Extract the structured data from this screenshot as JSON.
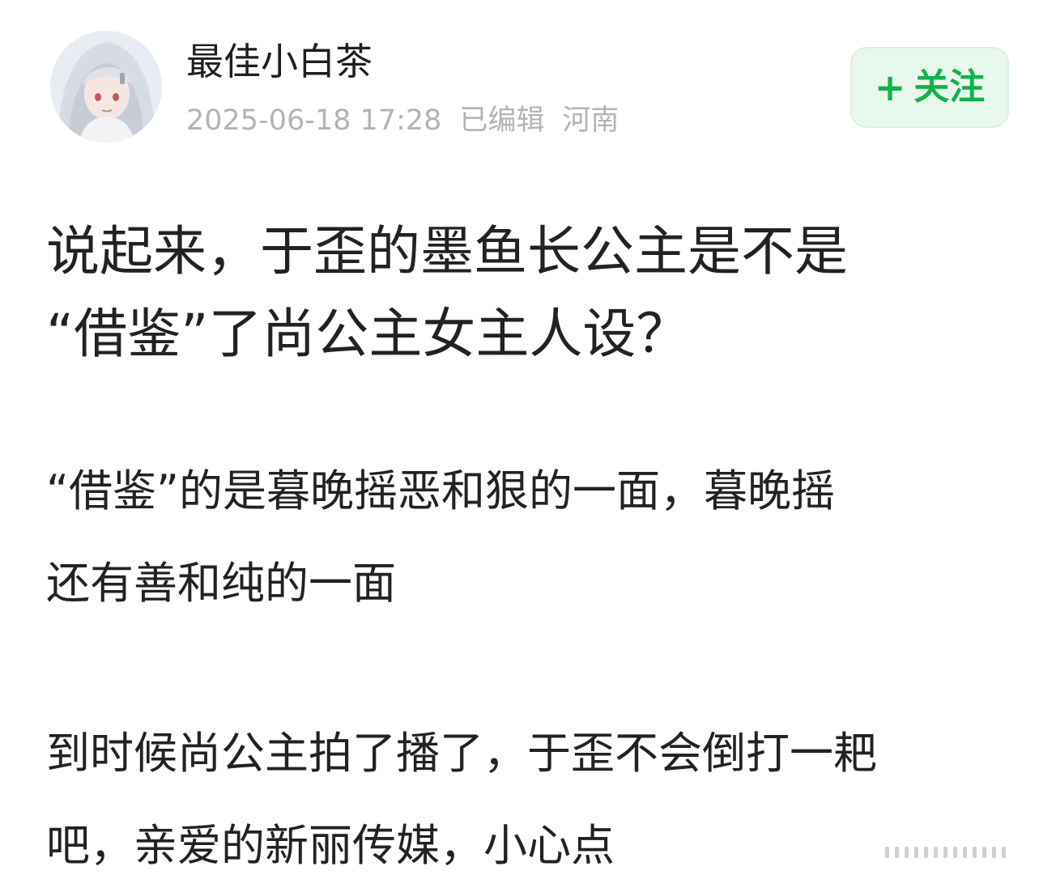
{
  "author": {
    "name": "最佳小白茶",
    "avatar_icon": "anime-girl-avatar"
  },
  "meta": {
    "timestamp": "2025-06-18 17:28",
    "edited": "已编辑",
    "location": "河南"
  },
  "follow": {
    "plus": "+",
    "label": "关注",
    "color": "#12b24b",
    "background": "#e9f8ec"
  },
  "post": {
    "title_line1": "说起来，于歪的墨鱼长公主是不是",
    "title_line2": "“借鉴”了尚公主女主人设？",
    "p1_line1": "“借鉴”的是暮晚摇恶和狠的一面，暮晚摇",
    "p1_line2": "还有善和纯的一面",
    "p2_line1": "到时候尚公主拍了播了，于歪不会倒打一耙",
    "p2_line2": "吧，亲爱的新丽传媒，小心点"
  }
}
